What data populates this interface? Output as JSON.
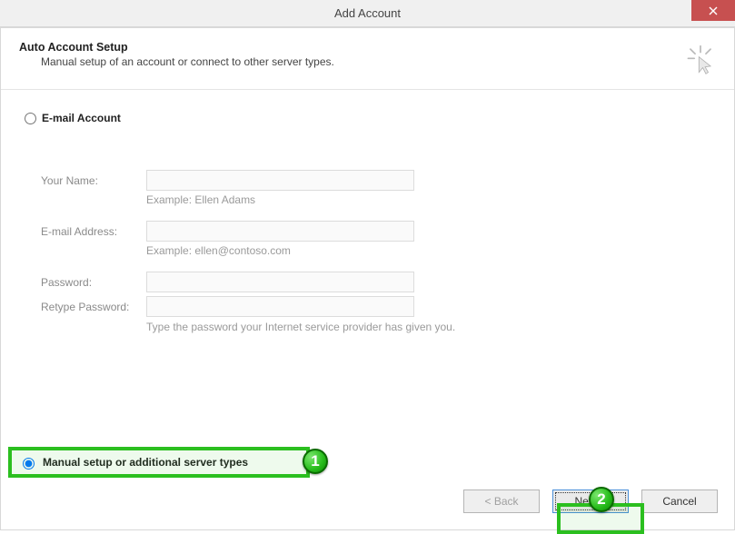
{
  "window": {
    "title": "Add Account"
  },
  "header": {
    "title": "Auto Account Setup",
    "subtitle": "Manual setup of an account or connect to other server types."
  },
  "options": {
    "email": {
      "label": "E-mail Account",
      "selected": false
    },
    "manual": {
      "label": "Manual setup or additional server types",
      "selected": true
    }
  },
  "fields": {
    "name": {
      "label": "Your Name:",
      "value": "",
      "hint": "Example: Ellen Adams"
    },
    "email": {
      "label": "E-mail Address:",
      "value": "",
      "hint": "Example: ellen@contoso.com"
    },
    "password": {
      "label": "Password:",
      "value": ""
    },
    "retype": {
      "label": "Retype Password:",
      "value": "",
      "hint": "Type the password your Internet service provider has given you."
    }
  },
  "buttons": {
    "back": "< Back",
    "next": "Next >",
    "cancel": "Cancel"
  },
  "annotations": {
    "step1": "1",
    "step2": "2"
  }
}
